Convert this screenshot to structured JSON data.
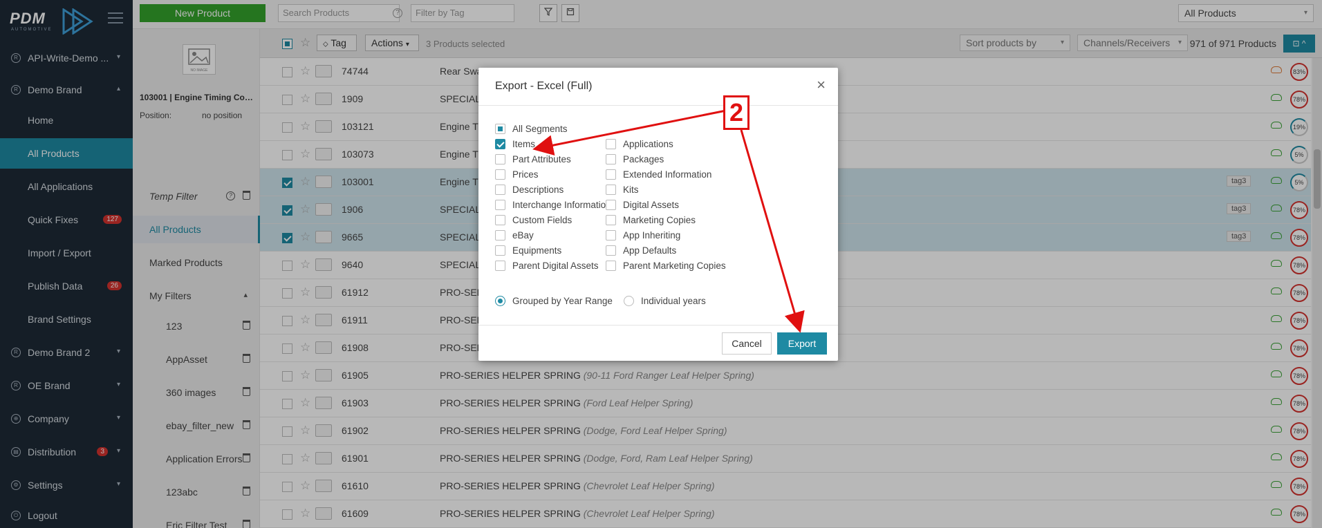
{
  "sidebar": {
    "logo_main": "PDM",
    "logo_sub": "AUTOMOTIVE",
    "items": [
      {
        "label": "API-Write-Demo ...",
        "icon": "R",
        "chevron": "▾"
      },
      {
        "label": "Demo Brand",
        "icon": "R",
        "chevron": "▴"
      },
      {
        "label": "Home"
      },
      {
        "label": "All Products"
      },
      {
        "label": "All Applications"
      },
      {
        "label": "Quick Fixes",
        "badge": "127"
      },
      {
        "label": "Import / Export"
      },
      {
        "label": "Publish Data",
        "badge": "26"
      },
      {
        "label": "Brand Settings"
      },
      {
        "label": "Demo Brand 2",
        "icon": "R",
        "chevron": "▾"
      },
      {
        "label": "OE Brand",
        "icon": "R",
        "chevron": "▾"
      },
      {
        "label": "Company",
        "icon": "⊕",
        "chevron": "▾"
      },
      {
        "label": "Distribution",
        "icon": "▤",
        "badge": "3",
        "chevron": "▾"
      },
      {
        "label": "Settings",
        "icon": "⚙",
        "chevron": "▾"
      },
      {
        "label": "Logout",
        "icon": "⏻"
      }
    ]
  },
  "topbar": {
    "new_product": "New Product",
    "search_placeholder": "Search Products",
    "tag_placeholder": "Filter by Tag",
    "scope": "All Products"
  },
  "filter_panel": {
    "no_image": "NO IMAGE",
    "product_title": "103001 | Engine Timing Cover...",
    "position_label": "Position:",
    "position_value": "no position",
    "items": [
      "Temp Filter",
      "All Products",
      "Marked Products",
      "My Filters"
    ],
    "my_filters": [
      "123",
      "AppAsset",
      "360 images",
      "ebay_filter_new",
      "Application Errors",
      "123abc",
      "Eric Filter Test"
    ]
  },
  "list_bar": {
    "tag": "Tag",
    "actions": "Actions",
    "selected": "3 Products selected",
    "sort": "Sort products by",
    "channels": "Channels/Receivers",
    "count": "971 of 971 Products"
  },
  "rows": [
    {
      "pn": "74744",
      "name": "Rear Sway",
      "desc": "",
      "sel": false,
      "tag": "",
      "pct": "83%",
      "cloud": "orange"
    },
    {
      "pn": "1909",
      "name": "SPECIAL D",
      "desc": "",
      "sel": false,
      "tag": "",
      "pct": "78%",
      "cloud": "green"
    },
    {
      "pn": "103121",
      "name": "Engine Ti",
      "desc": "",
      "sel": false,
      "tag": "",
      "pct": "19%",
      "cloud": "green"
    },
    {
      "pn": "103073",
      "name": "Engine Ti",
      "desc": "",
      "sel": false,
      "tag": "",
      "pct": "5%",
      "cloud": "green"
    },
    {
      "pn": "103001",
      "name": "Engine Ti",
      "desc": "",
      "sel": true,
      "tag": "tag3",
      "pct": "5%",
      "cloud": "green"
    },
    {
      "pn": "1906",
      "name": "SPECIAL D",
      "desc": "",
      "sel": true,
      "tag": "tag3",
      "pct": "78%",
      "cloud": "green"
    },
    {
      "pn": "9665",
      "name": "SPECIAL D",
      "desc": "",
      "sel": true,
      "tag": "tag3",
      "pct": "78%",
      "cloud": "green"
    },
    {
      "pn": "9640",
      "name": "SPECIAL D",
      "desc": "",
      "sel": false,
      "tag": "",
      "pct": "78%",
      "cloud": "green"
    },
    {
      "pn": "61912",
      "name": "PRO-SERI",
      "desc": "",
      "sel": false,
      "tag": "",
      "pct": "78%",
      "cloud": "green"
    },
    {
      "pn": "61911",
      "name": "PRO-SERI",
      "desc": "",
      "sel": false,
      "tag": "",
      "pct": "78%",
      "cloud": "green"
    },
    {
      "pn": "61908",
      "name": "PRO-SER",
      "desc": "",
      "sel": false,
      "tag": "",
      "pct": "78%",
      "cloud": "green"
    },
    {
      "pn": "61905",
      "name": "PRO-SERIES HELPER SPRING",
      "desc": "(90-11 Ford Ranger Leaf Helper Spring)",
      "sel": false,
      "tag": "",
      "pct": "78%",
      "cloud": "green"
    },
    {
      "pn": "61903",
      "name": "PRO-SERIES HELPER SPRING",
      "desc": "(Ford Leaf Helper Spring)",
      "sel": false,
      "tag": "",
      "pct": "78%",
      "cloud": "green"
    },
    {
      "pn": "61902",
      "name": "PRO-SERIES HELPER SPRING",
      "desc": "(Dodge, Ford Leaf Helper Spring)",
      "sel": false,
      "tag": "",
      "pct": "78%",
      "cloud": "green"
    },
    {
      "pn": "61901",
      "name": "PRO-SERIES HELPER SPRING",
      "desc": "(Dodge, Ford, Ram Leaf Helper Spring)",
      "sel": false,
      "tag": "",
      "pct": "78%",
      "cloud": "green"
    },
    {
      "pn": "61610",
      "name": "PRO-SERIES HELPER SPRING",
      "desc": "(Chevrolet Leaf Helper Spring)",
      "sel": false,
      "tag": "",
      "pct": "78%",
      "cloud": "green"
    },
    {
      "pn": "61609",
      "name": "PRO-SERIES HELPER SPRING",
      "desc": "(Chevrolet Leaf Helper Spring)",
      "sel": false,
      "tag": "",
      "pct": "78%",
      "cloud": "green"
    }
  ],
  "modal": {
    "title": "Export - Excel (Full)",
    "all_segments": "All Segments",
    "left": [
      {
        "label": "Items",
        "checked": true
      },
      {
        "label": "Part Attributes",
        "checked": false
      },
      {
        "label": "Prices",
        "checked": false
      },
      {
        "label": "Descriptions",
        "checked": false
      },
      {
        "label": "Interchange Information",
        "checked": false
      },
      {
        "label": "Custom Fields",
        "checked": false
      },
      {
        "label": "eBay",
        "checked": false
      },
      {
        "label": "Equipments",
        "checked": false
      },
      {
        "label": "Parent Digital Assets",
        "checked": false
      }
    ],
    "right": [
      {
        "label": "Applications",
        "checked": false
      },
      {
        "label": "Packages",
        "checked": false
      },
      {
        "label": "Extended Information",
        "checked": false
      },
      {
        "label": "Kits",
        "checked": false
      },
      {
        "label": "Digital Assets",
        "checked": false
      },
      {
        "label": "Marketing Copies",
        "checked": false
      },
      {
        "label": "App Inheriting",
        "checked": false
      },
      {
        "label": "App Defaults",
        "checked": false
      },
      {
        "label": "Parent Marketing Copies",
        "checked": false
      }
    ],
    "radio_grouped": "Grouped by Year Range",
    "radio_individual": "Individual years",
    "cancel": "Cancel",
    "export": "Export"
  },
  "annotation": {
    "step": "2"
  },
  "colors": {
    "accent": "#1e8aa3",
    "sidebar": "#1e2a36",
    "new_product": "#34a32c",
    "badge": "#d5322e",
    "annotation": "#e01010"
  }
}
